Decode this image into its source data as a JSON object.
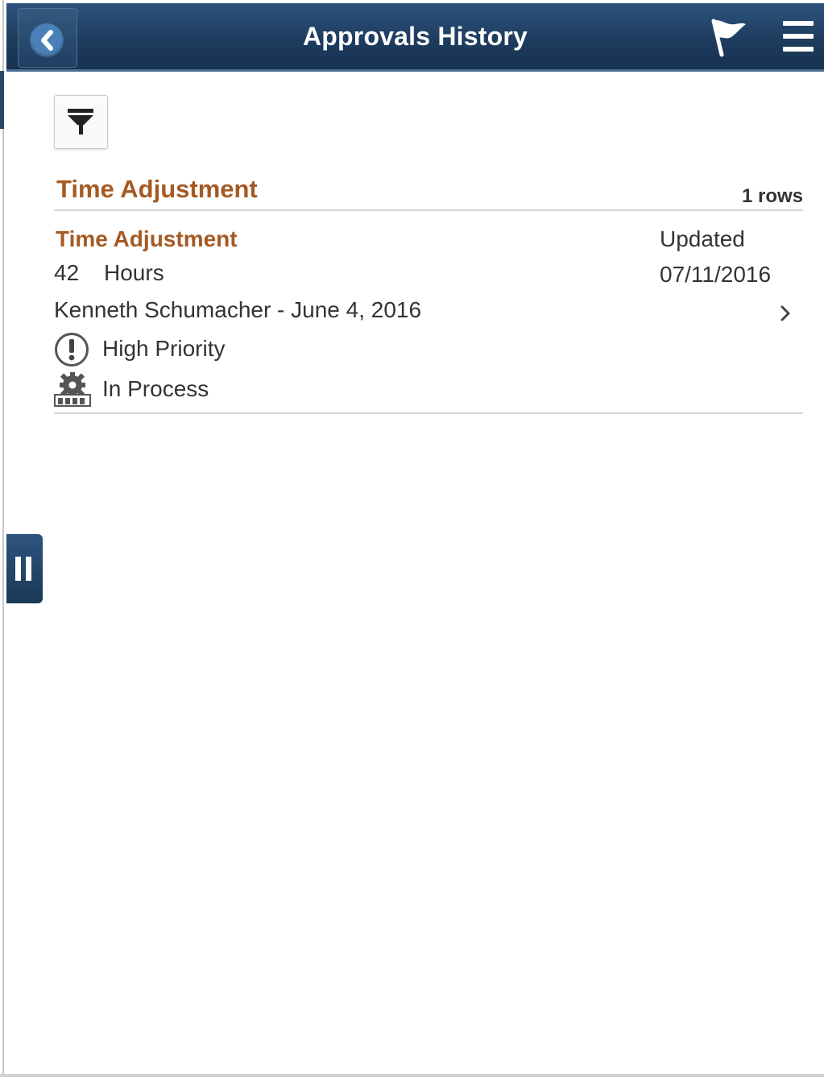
{
  "header": {
    "title": "Approvals History",
    "back_icon": "chevron-left-icon",
    "actions": [
      {
        "name": "flag",
        "icon": "flag-icon"
      },
      {
        "name": "menu",
        "icon": "hamburger-menu-icon"
      }
    ]
  },
  "toolbar": {
    "filter_icon": "funnel-filter-icon"
  },
  "group": {
    "title": "Time Adjustment",
    "rows_count": "1 rows"
  },
  "items": [
    {
      "title": "Time Adjustment",
      "quantity": "42",
      "unit": "Hours",
      "description": "Kenneth Schumacher - June 4, 2016",
      "status_label": "Updated",
      "status_date": "07/11/2016",
      "priority": "High Priority",
      "priority_icon": "exclamation-circle-icon",
      "state": "In Process",
      "state_icon": "gear-in-process-icon"
    }
  ],
  "side_tab": {
    "icon": "pause-bars-icon"
  },
  "colors": {
    "header_bg": "#1e3c5e",
    "accent_orange": "#a45a22",
    "text": "#333333"
  }
}
